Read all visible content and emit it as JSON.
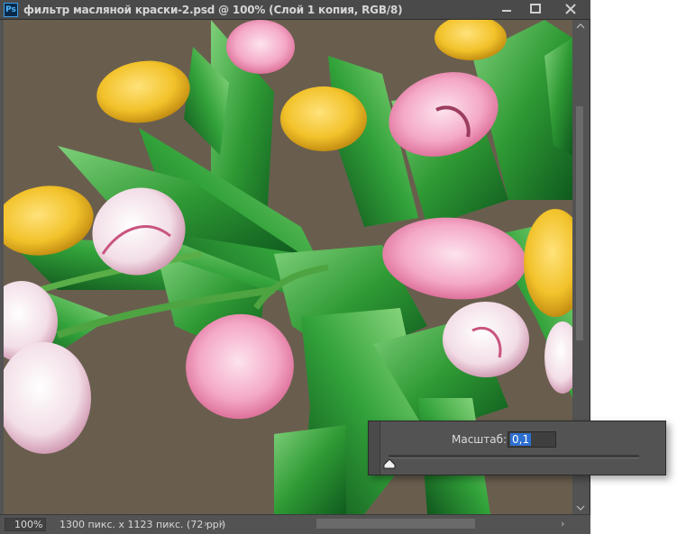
{
  "window": {
    "app_icon": "Ps",
    "title": "фильтр масляной краски-2.psd @ 100% (Слой 1 копия, RGB/8)",
    "buttons": {
      "minimize": "minimize-icon",
      "maximize": "maximize-icon",
      "close": "close-icon"
    }
  },
  "canvas": {
    "content": "oil-paint-filtered photo of pink, white and yellow tulips with green leaves",
    "background_color": "#6e6352",
    "accent_colors": {
      "pink": "#f3a5c4",
      "yellow": "#f2c22a",
      "green": "#2f9a34"
    }
  },
  "status": {
    "zoom": "100%",
    "doc_info": "1300 пикс. x 1123 пикс. (72 ppi)",
    "arrow": "›"
  },
  "scale_popup": {
    "label": "Масштаб:",
    "value": "0,1"
  }
}
